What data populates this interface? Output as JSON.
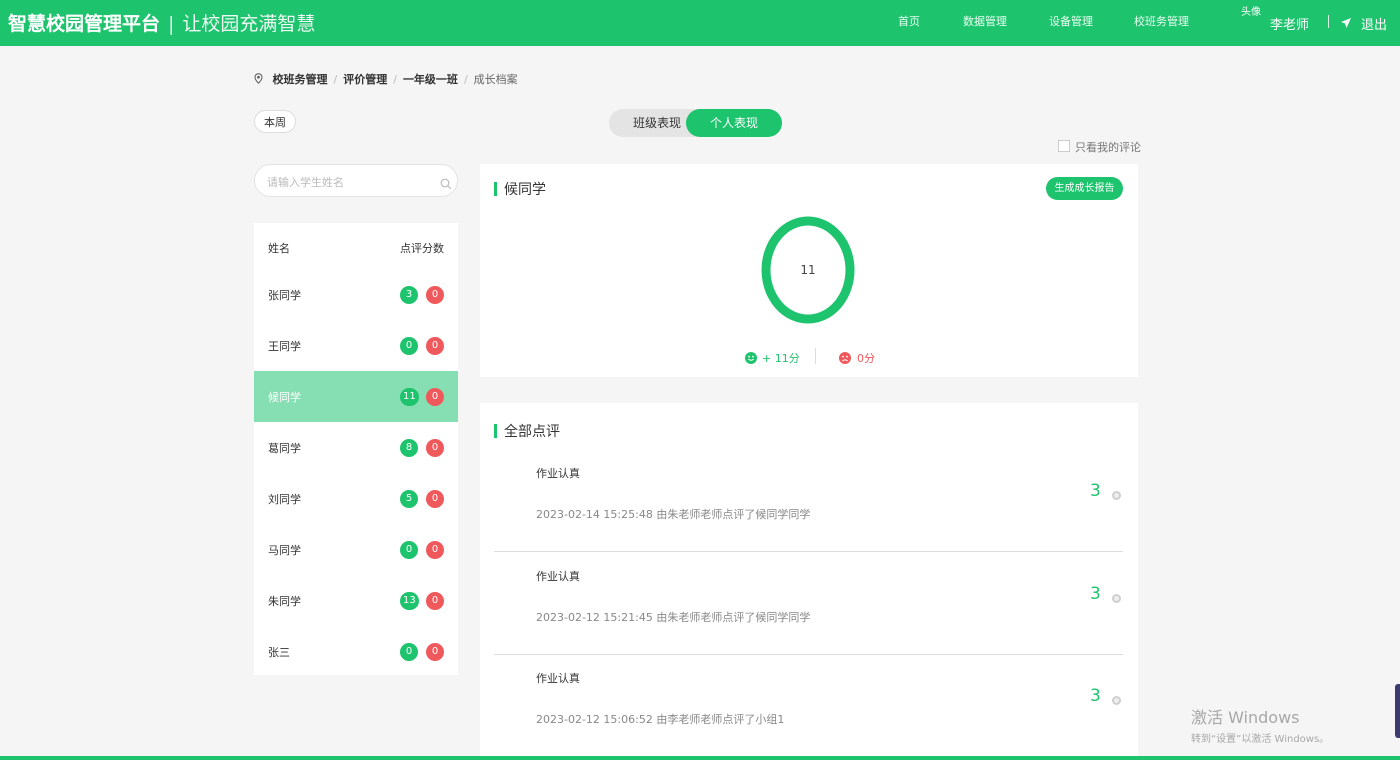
{
  "header": {
    "brand": "智慧校园管理平台",
    "separator": "|",
    "slogan": "让校园充满智慧",
    "nav": [
      "首页",
      "数据管理",
      "设备管理",
      "校班务管理"
    ],
    "avatar_alt": "头像",
    "user_name": "李老师",
    "logout": "退出"
  },
  "breadcrumb": {
    "items": [
      "校班务管理",
      "评价管理",
      "一年级一班"
    ],
    "current": "成长档案",
    "separator": "/"
  },
  "week_button": "本周",
  "tabs": {
    "class": "班级表现",
    "personal": "个人表现"
  },
  "only_mine": "只看我的评论",
  "search": {
    "placeholder": "请输入学生姓名"
  },
  "student_list": {
    "header_name": "姓名",
    "header_score": "点评分数",
    "selected": "候同学",
    "rows": [
      {
        "name": "张同学",
        "positive": "3",
        "negative": "0"
      },
      {
        "name": "王同学",
        "positive": "0",
        "negative": "0"
      },
      {
        "name": "候同学",
        "positive": "11",
        "negative": "0"
      },
      {
        "name": "葛同学",
        "positive": "8",
        "negative": "0"
      },
      {
        "name": "刘同学",
        "positive": "5",
        "negative": "0"
      },
      {
        "name": "马同学",
        "positive": "0",
        "negative": "0"
      },
      {
        "name": "朱同学",
        "positive": "13",
        "negative": "0"
      },
      {
        "name": "张三",
        "positive": "0",
        "negative": "0"
      }
    ]
  },
  "profile": {
    "student_name": "候同学",
    "report_button": "生成成长报告",
    "total": "11",
    "positive_text": "+ 11分",
    "negative_text": "0分"
  },
  "comments": {
    "title": "全部点评",
    "items": [
      {
        "title": "作业认真",
        "meta": "2023-02-14 15:25:48 由朱老师老师点评了候同学同学",
        "score": "3"
      },
      {
        "title": "作业认真",
        "meta": "2023-02-12 15:21:45 由朱老师老师点评了候同学同学",
        "score": "3"
      },
      {
        "title": "作业认真",
        "meta": "2023-02-12 15:06:52 由李老师老师点评了小组1",
        "score": "3"
      }
    ]
  },
  "watermark": {
    "line1": "激活 Windows",
    "line2": "转到“设置”以激活 Windows。"
  },
  "colors": {
    "primary": "#1ec36d",
    "negative": "#f0595c",
    "selected_row": "#86dfb2"
  }
}
